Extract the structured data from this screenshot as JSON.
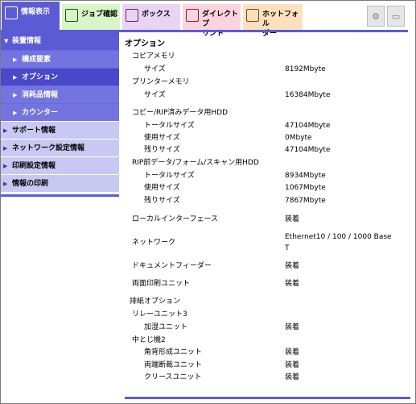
{
  "tabs": [
    {
      "label": "情報表示",
      "icon": "info-display-icon",
      "active": true
    },
    {
      "label": "ジョブ確認",
      "icon": "job-check-icon"
    },
    {
      "label": "ボックス",
      "icon": "box-icon"
    },
    {
      "label": "ダイレクトプリント",
      "icon": "direct-print-icon"
    },
    {
      "label": "ホットフォルダー",
      "icon": "hot-folder-icon"
    }
  ],
  "tab_labels": {
    "t1": "情報表示",
    "t2": "ジョブ確認",
    "t3": "ボックス",
    "t4a": "ダイレクトプ",
    "t4b": "リント",
    "t5a": "ホットフォル",
    "t5b": "ダー"
  },
  "utility": {
    "u1_icon": "device-icon",
    "u2_icon": "display-icon"
  },
  "sidebar": {
    "device_info": "装置情報",
    "sub": {
      "components": "構成要素",
      "options": "オプション",
      "consumables": "消耗品情報",
      "counter": "カウンター"
    },
    "support": "サポート情報",
    "network": "ネットワーク設定情報",
    "print_settings": "印刷設定情報",
    "info_print": "情報の印刷"
  },
  "main": {
    "title": "オプション",
    "copy_memory": "コピアメモリ",
    "copy_memory_size_label": "サイズ",
    "copy_memory_size": "8192Mbyte",
    "printer_memory": "プリンターメモリ",
    "printer_memory_size_label": "サイズ",
    "printer_memory_size": "16384Mbyte",
    "hdd1": "コピー/RIP済みデータ用HDD",
    "hdd1_total_label": "トータルサイズ",
    "hdd1_total": "47104Mbyte",
    "hdd1_used_label": "使用サイズ",
    "hdd1_used": "0Mbyte",
    "hdd1_remain_label": "残りサイズ",
    "hdd1_remain": "47104Mbyte",
    "hdd2": "RIP前データ/フォーム/スキャン用HDD",
    "hdd2_total_label": "トータルサイズ",
    "hdd2_total": "8934Mbyte",
    "hdd2_used_label": "使用サイズ",
    "hdd2_used": "1067Mbyte",
    "hdd2_remain_label": "残りサイズ",
    "hdd2_remain": "7867Mbyte",
    "local_if_label": "ローカルインターフェース",
    "local_if": "装着",
    "network_label": "ネットワーク",
    "network_line1": "Ethernet10 / 100 / 1000 Base",
    "network_line2": "T",
    "doc_feeder_label": "ドキュメントフィーダー",
    "doc_feeder": "装着",
    "duplex_label": "両面印刷ユニット",
    "duplex": "装着",
    "output_options": "排紙オプション",
    "relay_unit": "リレーユニット3",
    "humidifier_label": "加湿ユニット",
    "humidifier": "装着",
    "finisher": "中とじ機2",
    "corner_label": "角背形成ユニット",
    "corner": "装着",
    "trimmer_label": "両端断裁ユニット",
    "trimmer": "装着",
    "crease_label": "クリースユニット",
    "crease": "装着"
  },
  "colors": {
    "accent": "#5b5bd6",
    "sidebar_light": "#c8c8f2"
  }
}
